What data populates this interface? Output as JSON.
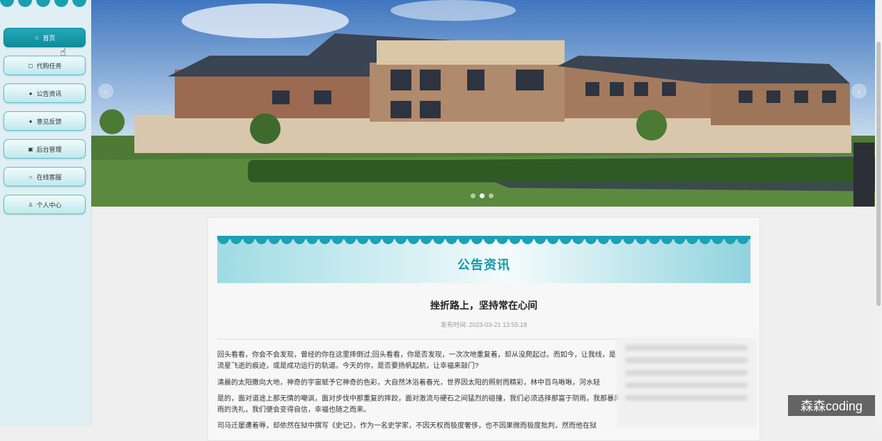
{
  "sidebar": {
    "items": [
      {
        "label": "首页",
        "icon": "star-icon",
        "active": true
      },
      {
        "label": "代购任务",
        "icon": "bag-icon"
      },
      {
        "label": "公告资讯",
        "icon": "info-icon"
      },
      {
        "label": "意见反馈",
        "icon": "question-icon"
      },
      {
        "label": "后台管理",
        "icon": "box-icon"
      },
      {
        "label": "在线客服",
        "icon": "headset-icon"
      },
      {
        "label": "个人中心",
        "icon": "user-icon"
      }
    ]
  },
  "banner": {
    "prev": "‹",
    "next": "›",
    "slide_count": 3,
    "active_slide": 2
  },
  "section": {
    "title": "公告资讯"
  },
  "article": {
    "title": "挫折路上，坚持常在心间",
    "meta_label": "发布时间:",
    "date": "2023-03-21 13:55:18",
    "paragraphs": [
      "回头看看，你会不会发现，曾经的你在这里摔倒过;回头看看，你是否发现，一次次地重复着，却从没爬起过。而如今，让我线，是流星飞逝的痕迹，或是成功运行的轨道。今天的你，是否要扬帆起航，让幸福来敲门?",
      "清晨的太阳撒向大地，神奇的宇宙赋予它神奇的色彩，大自然沐浴着春光，世界因太阳的照射而精彩，林中百鸟啾啾，河水轻",
      "是的，面对道途上那无情的嘲讽，面对步伐中那重复的摔跤，面对激流与硬石之间猛烈的碰撞，我们必须选择那富于阴雨，我那暴风雨的洗礼，我们便会变得自信，幸福也随之而来。",
      "司马迁屡遭着辱，却依然在狱中撰写《史记》，作为一名史学家，不因天权而极度奢侈，也不因果微而极度批判，然而他在狱"
    ]
  },
  "watermark": "森森coding",
  "colors": {
    "accent": "#149aac",
    "nav_active": "#1699a9"
  }
}
